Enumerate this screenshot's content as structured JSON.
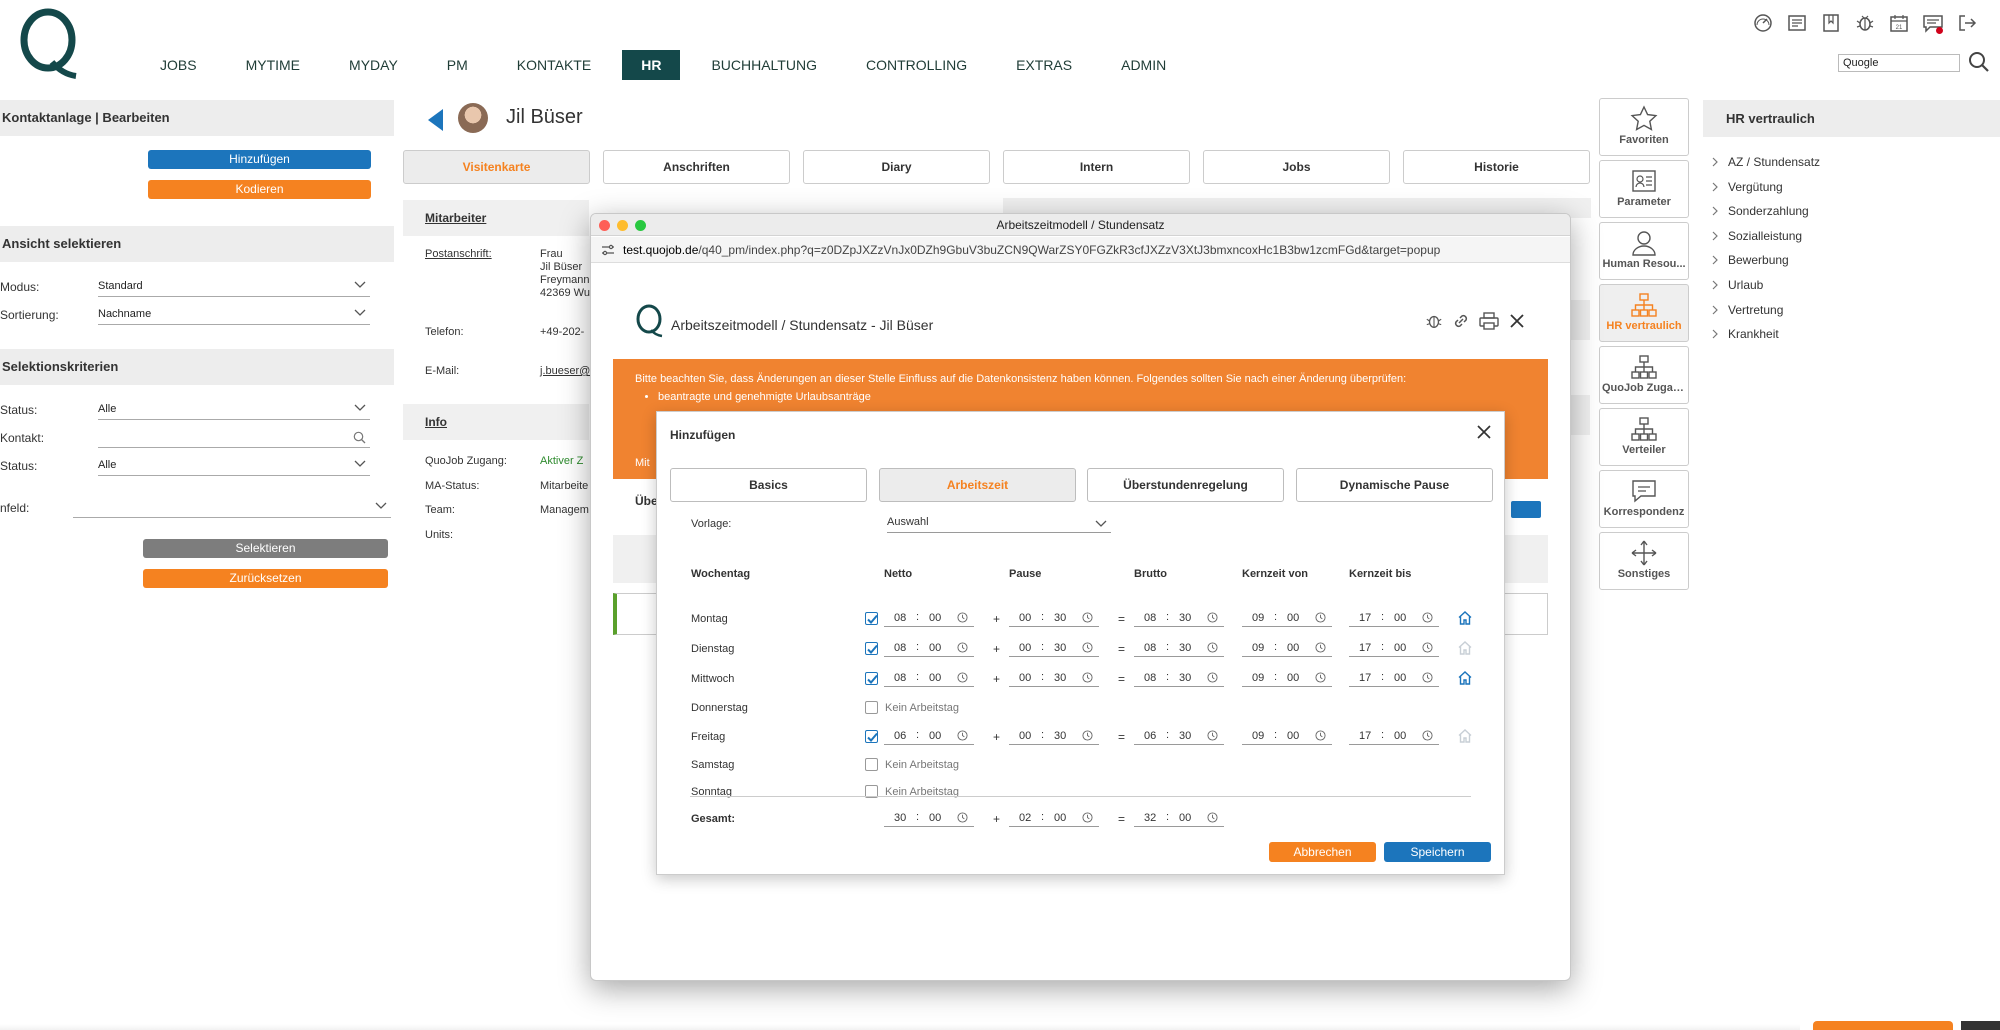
{
  "nav": {
    "items": [
      {
        "label": "JOBS",
        "active": false
      },
      {
        "label": "MYTIME",
        "active": false
      },
      {
        "label": "MYDAY",
        "active": false
      },
      {
        "label": "PM",
        "active": false
      },
      {
        "label": "KONTAKTE",
        "active": false
      },
      {
        "label": "HR",
        "active": true
      },
      {
        "label": "BUCHHALTUNG",
        "active": false
      },
      {
        "label": "CONTROLLING",
        "active": false
      },
      {
        "label": "EXTRAS",
        "active": false
      },
      {
        "label": "ADMIN",
        "active": false
      }
    ],
    "search_value": "Quogle",
    "icons": [
      "dashboard-icon",
      "news-icon",
      "bookmark-icon",
      "bug-icon",
      "calendar-icon",
      "chat-icon",
      "logout-icon"
    ],
    "calendar_day": "21"
  },
  "left": {
    "header": "Kontaktanlage | Bearbeiten",
    "add_button": "Hinzufügen",
    "code_button": "Kodieren",
    "view_header": "Ansicht selektieren",
    "mode_label": "Modus:",
    "mode_value": "Standard",
    "sort_label": "Sortierung:",
    "sort_value": "Nachname",
    "criteria_header": "Selektionskriterien",
    "status1_label": "Status:",
    "status1_value": "Alle",
    "contact_label": "Kontakt:",
    "contact_value": "",
    "status2_label": "Status:",
    "status2_value": "Alle",
    "field_label": "nfeld:",
    "field_value": "",
    "select_button": "Selektieren",
    "reset_button": "Zurücksetzen"
  },
  "center": {
    "name": "Jil Büser",
    "tabs": [
      "Visitenkarte",
      "Anschriften",
      "Diary",
      "Intern",
      "Jobs",
      "Historie"
    ],
    "active_tab": "Visitenkarte",
    "employee_header": "Mitarbeiter",
    "address_label": "Postanschrift:",
    "address_lines": [
      "Frau",
      "Jil Büser",
      "Freymann",
      "42369 Wu"
    ],
    "phone_label": "Telefon:",
    "phone_value": "+49-202-",
    "email_label": "E-Mail:",
    "email_value": "j.bueser@",
    "info_header": "Info",
    "info_rows": [
      {
        "label": "QuoJob Zugang:",
        "value": "Aktiver Z"
      },
      {
        "label": "MA-Status:",
        "value": "Mitarbeite"
      },
      {
        "label": "Team:",
        "value": "Managem"
      },
      {
        "label": "Units:",
        "value": ""
      }
    ]
  },
  "right": {
    "buttons": [
      {
        "label": "Favoriten",
        "icon": "star-icon",
        "active": false
      },
      {
        "label": "Parameter",
        "icon": "id-card-icon",
        "active": false
      },
      {
        "label": "Human Resou...",
        "icon": "person-icon",
        "active": false
      },
      {
        "label": "HR vertraulich",
        "icon": "org-chart-icon",
        "active": true
      },
      {
        "label": "QuoJob Zugang",
        "icon": "org-chart-icon",
        "active": false
      },
      {
        "label": "Verteiler",
        "icon": "org-chart-icon",
        "active": false
      },
      {
        "label": "Korrespondenz",
        "icon": "speech-bubble-icon",
        "active": false
      },
      {
        "label": "Sonstiges",
        "icon": "move-icon",
        "active": false
      }
    ],
    "hr_header": "HR vertraulich",
    "hr_items": [
      "AZ / Stundensatz",
      "Vergütung",
      "Sonderzahlung",
      "Sozialleistung",
      "Bewerbung",
      "Urlaub",
      "Vertretung",
      "Krankheit"
    ]
  },
  "popup": {
    "window_title": "Arbeitszeitmodell / Stundensatz",
    "url_host": "test.quojob.de",
    "url_path": "/q40_pm/index.php?q=z0DZpJXZzVnJx0DZh9GbuV3buZCN9QWarZSY0FGZkR3cfJXZzV3XtJ3bmxncoxHc1B3bw1zcmFGd&target=popup",
    "title": "Arbeitszeitmodell / Stundensatz - Jil Büser",
    "warning": "Bitte beachten Sie, dass Änderungen an dieser Stelle Einfluss auf die Datenkonsistenz haben können. Folgendes sollten Sie nach einer Änderung überprüfen:",
    "warning_items": [
      "beantragte und genehmigte Urlaubsanträge"
    ],
    "behind_text": "Mit",
    "behind_heading": "Übe"
  },
  "modal": {
    "title": "Hinzufügen",
    "tabs": [
      "Basics",
      "Arbeitszeit",
      "Überstundenregelung",
      "Dynamische Pause"
    ],
    "active_tab": "Arbeitszeit",
    "template_label": "Vorlage:",
    "template_value": "Auswahl",
    "columns": [
      "Wochentag",
      "Netto",
      "Pause",
      "Brutto",
      "Kernzeit von",
      "Kernzeit bis"
    ],
    "no_workday_label": "Kein Arbeitstag",
    "days": [
      {
        "name": "Montag",
        "workday": true,
        "netto_h": "08",
        "netto_m": "00",
        "pause_h": "00",
        "pause_m": "30",
        "brutto_h": "08",
        "brutto_m": "30",
        "von_h": "09",
        "von_m": "00",
        "bis_h": "17",
        "bis_m": "00",
        "home_office": true
      },
      {
        "name": "Dienstag",
        "workday": true,
        "netto_h": "08",
        "netto_m": "00",
        "pause_h": "00",
        "pause_m": "30",
        "brutto_h": "08",
        "brutto_m": "30",
        "von_h": "09",
        "von_m": "00",
        "bis_h": "17",
        "bis_m": "00",
        "home_office": false
      },
      {
        "name": "Mittwoch",
        "workday": true,
        "netto_h": "08",
        "netto_m": "00",
        "pause_h": "00",
        "pause_m": "30",
        "brutto_h": "08",
        "brutto_m": "30",
        "von_h": "09",
        "von_m": "00",
        "bis_h": "17",
        "bis_m": "00",
        "home_office": true
      },
      {
        "name": "Donnerstag",
        "workday": false
      },
      {
        "name": "Freitag",
        "workday": true,
        "netto_h": "06",
        "netto_m": "00",
        "pause_h": "00",
        "pause_m": "30",
        "brutto_h": "06",
        "brutto_m": "30",
        "von_h": "09",
        "von_m": "00",
        "bis_h": "17",
        "bis_m": "00",
        "home_office": false
      },
      {
        "name": "Samstag",
        "workday": false
      },
      {
        "name": "Sonntag",
        "workday": false
      }
    ],
    "total_label": "Gesamt:",
    "total": {
      "netto_h": "30",
      "netto_m": "00",
      "pause_h": "02",
      "pause_m": "00",
      "brutto_h": "32",
      "brutto_m": "00"
    },
    "cancel_button": "Abbrechen",
    "save_button": "Speichern"
  },
  "colors": {
    "primary": "#14484a",
    "accent": "#f58220",
    "blue": "#1c75bc",
    "warning": "#f08330"
  }
}
